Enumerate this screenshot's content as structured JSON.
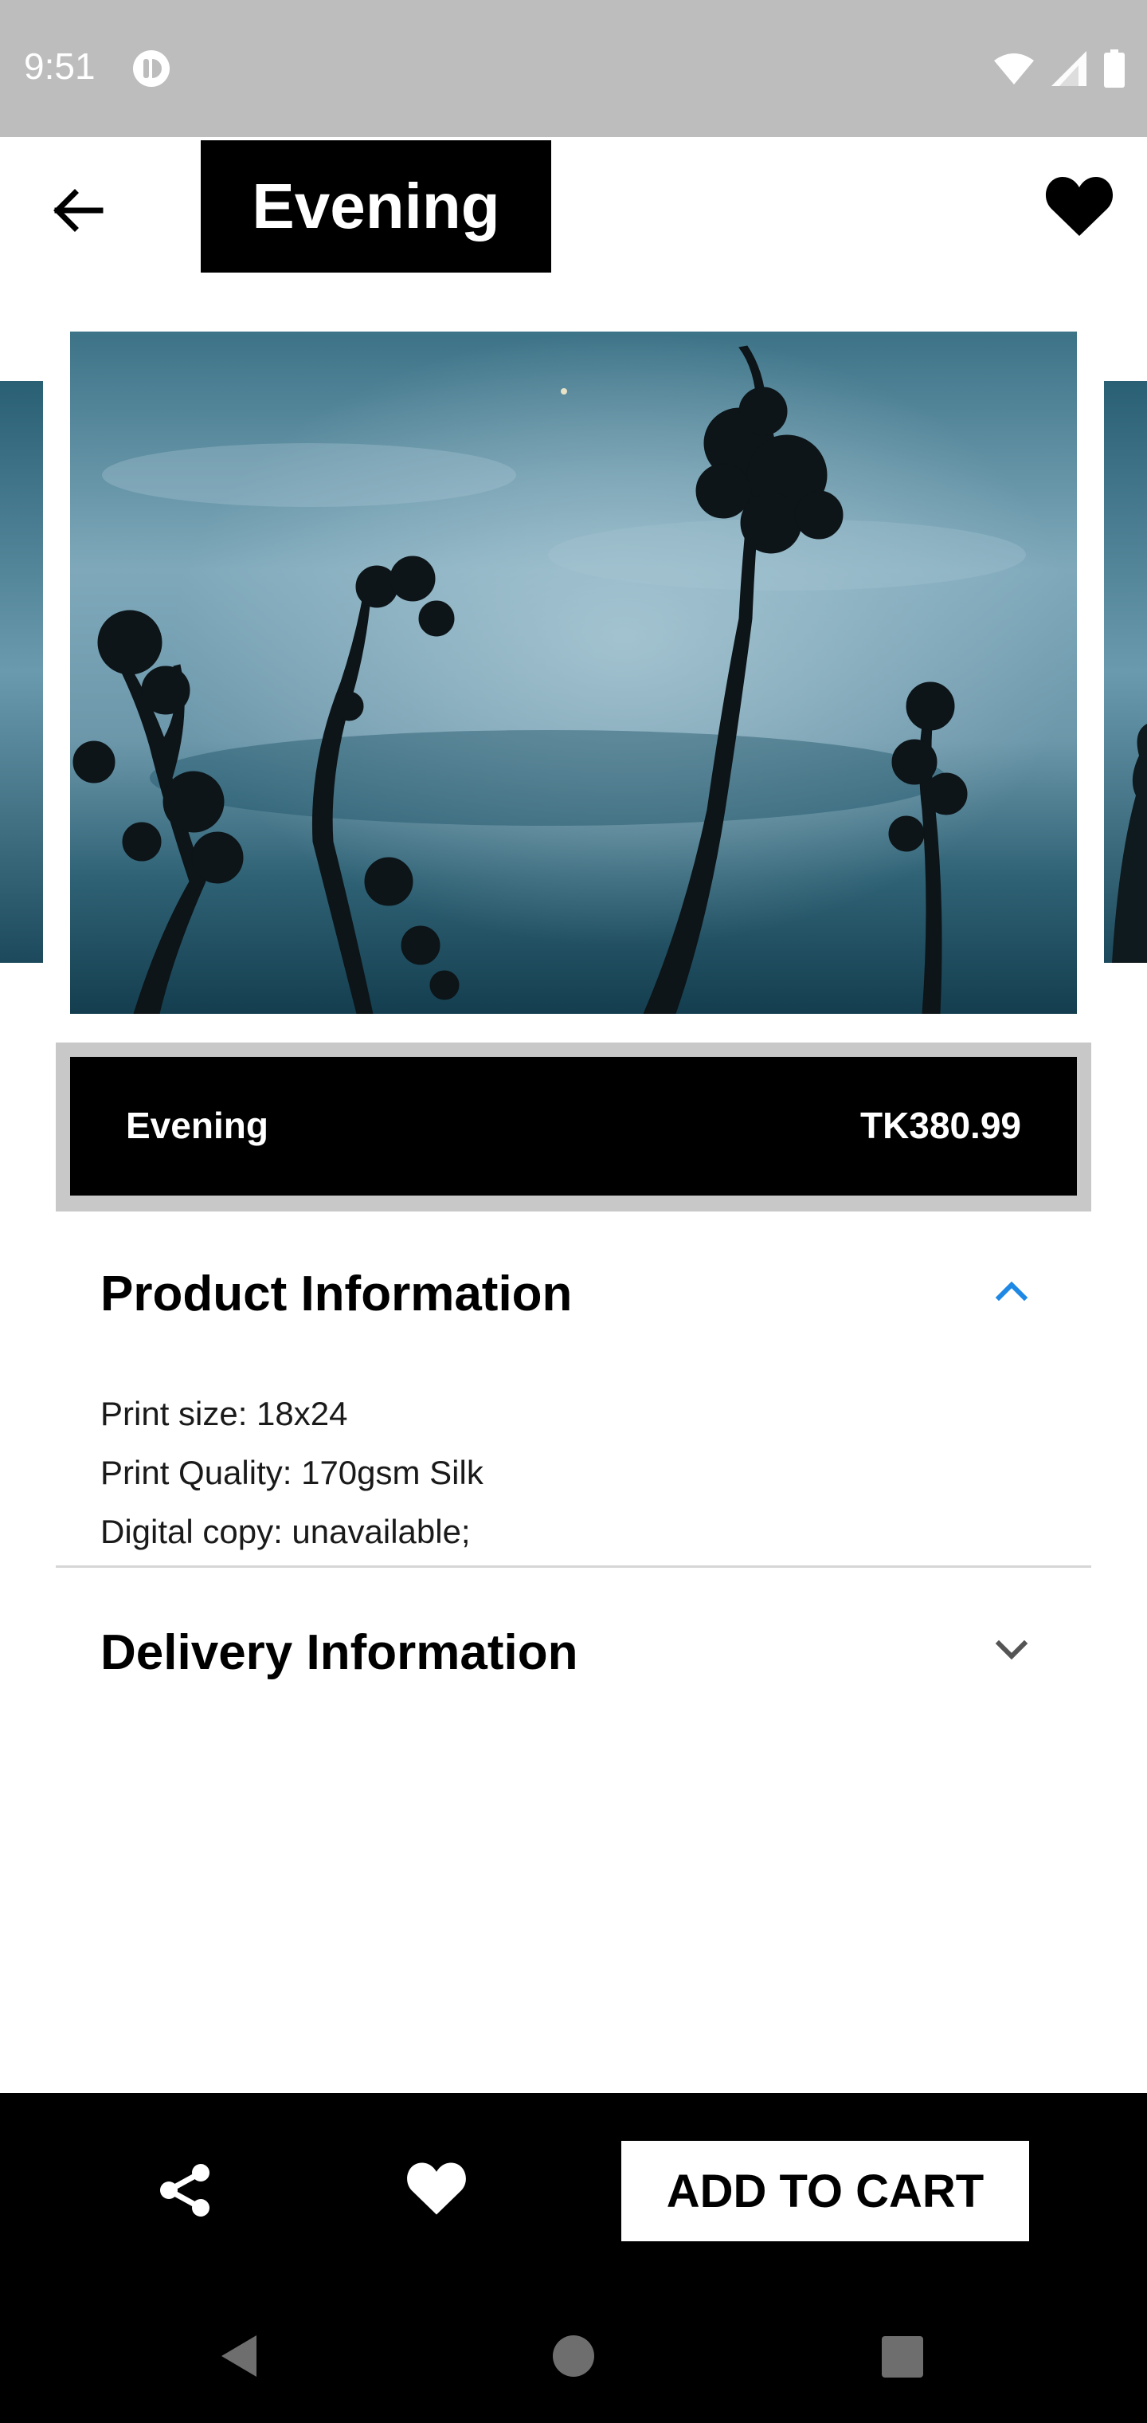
{
  "status_bar": {
    "time": "9:51"
  },
  "header": {
    "title": "Evening"
  },
  "product": {
    "name": "Evening",
    "price": "TK380.99"
  },
  "product_info": {
    "title": "Product Information",
    "expanded": true,
    "lines": [
      "Print size: 18x24",
      "Print Quality: 170gsm Silk",
      "Digital copy: unavailable;"
    ]
  },
  "delivery_info": {
    "title": "Delivery Information",
    "expanded": false
  },
  "actions": {
    "add_to_cart_label": "ADD TO CART"
  },
  "colors": {
    "accent": "#1e88e5",
    "primary": "#000000",
    "status_bar": "#bdbdbd"
  },
  "icons": [
    "back-arrow-icon",
    "heart-icon",
    "share-icon",
    "chevron-up-icon",
    "chevron-down-icon"
  ]
}
